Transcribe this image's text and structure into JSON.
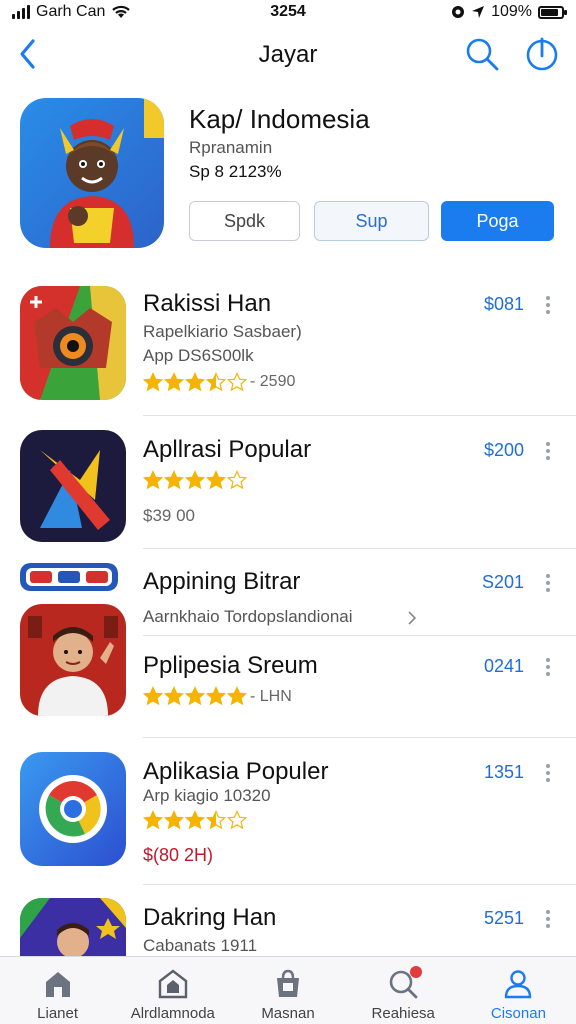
{
  "status": {
    "carrier": "Garh Can",
    "time": "3254",
    "battery": "109%",
    "battery_level": 0.85
  },
  "nav": {
    "title": "Jayar"
  },
  "featured": {
    "title": "Kap/ Indomesia",
    "subtitle": "Rpranamin",
    "price": "Sp 8 2123%",
    "buttons": [
      "Spdk",
      "Sup",
      "Poga"
    ]
  },
  "apps": [
    {
      "title": "Rakissi Han",
      "subtitle": "Rapelkiario Sasbaer)",
      "subtitle2": "App DS6S00lk",
      "rating": 3.5,
      "rating_extra": "- 2590",
      "price": "$081"
    },
    {
      "title": "Apllrasi Popular",
      "rating": 4,
      "price_line": "$39 00",
      "price": "$200"
    },
    {
      "title": "Appining Bitrar",
      "subtitle": "Aarnkhaio Tordopslandionai",
      "price": "S201"
    },
    {
      "title": "Pplipesia Sreum",
      "rating": 5,
      "rating_extra": "- LHN",
      "price": "0241"
    },
    {
      "title": "Aplikasia Populer",
      "subtitle": "Arp kiagio 10320",
      "rating": 3.5,
      "sale": "$(80 2H)",
      "price": "1351"
    },
    {
      "title": "Dakring Han",
      "subtitle": "Cabanats 1911",
      "price": "5251"
    }
  ],
  "tabs": [
    {
      "label": "Lianet",
      "icon": "home-icon"
    },
    {
      "label": "Alrdlamnoda",
      "icon": "store-icon"
    },
    {
      "label": "Masnan",
      "icon": "bag-icon"
    },
    {
      "label": "Reahiesa",
      "icon": "search-badge-icon"
    },
    {
      "label": "Cisonan",
      "icon": "person-icon",
      "active": true
    }
  ],
  "colors": {
    "accent": "#1b7cf0",
    "star": "#f5b400",
    "sale": "#c0182b"
  }
}
